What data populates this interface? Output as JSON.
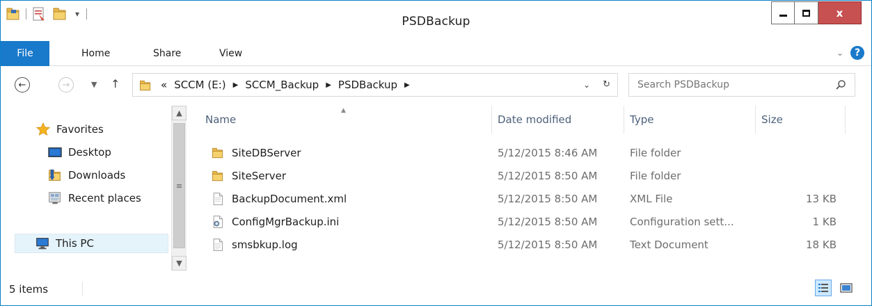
{
  "window": {
    "title": "PSDBackup",
    "close_label": "x"
  },
  "ribbon": {
    "tabs": [
      "File",
      "Home",
      "Share",
      "View"
    ]
  },
  "address": {
    "overflow": "«",
    "crumbs": [
      "SCCM (E:)",
      "SCCM_Backup",
      "PSDBackup"
    ]
  },
  "search": {
    "placeholder": "Search PSDBackup"
  },
  "navpane": {
    "items": [
      {
        "label": "Favorites",
        "icon": "star-icon"
      },
      {
        "label": "Desktop",
        "icon": "desktop-icon"
      },
      {
        "label": "Downloads",
        "icon": "downloads-folder-icon"
      },
      {
        "label": "Recent places",
        "icon": "recent-places-icon"
      },
      {
        "label": "This PC",
        "icon": "this-pc-icon"
      }
    ]
  },
  "columns": [
    "Name",
    "Date modified",
    "Type",
    "Size"
  ],
  "files": [
    {
      "name": "SiteDBServer",
      "date": "5/12/2015 8:46 AM",
      "type": "File folder",
      "size": "",
      "icon": "folder-icon"
    },
    {
      "name": "SiteServer",
      "date": "5/12/2015 8:50 AM",
      "type": "File folder",
      "size": "",
      "icon": "folder-icon"
    },
    {
      "name": "BackupDocument.xml",
      "date": "5/12/2015 8:50 AM",
      "type": "XML File",
      "size": "13 KB",
      "icon": "xml-file-icon"
    },
    {
      "name": "ConfigMgrBackup.ini",
      "date": "5/12/2015 8:50 AM",
      "type": "Configuration sett...",
      "size": "1 KB",
      "icon": "settings-file-icon"
    },
    {
      "name": "smsbkup.log",
      "date": "5/12/2015 8:50 AM",
      "type": "Text Document",
      "size": "18 KB",
      "icon": "text-file-icon"
    }
  ],
  "status": {
    "item_count": "5 items"
  },
  "colors": {
    "accent": "#1979ca",
    "close": "#c75050",
    "folder": "#e8b84a",
    "header_text": "#4c607a"
  }
}
